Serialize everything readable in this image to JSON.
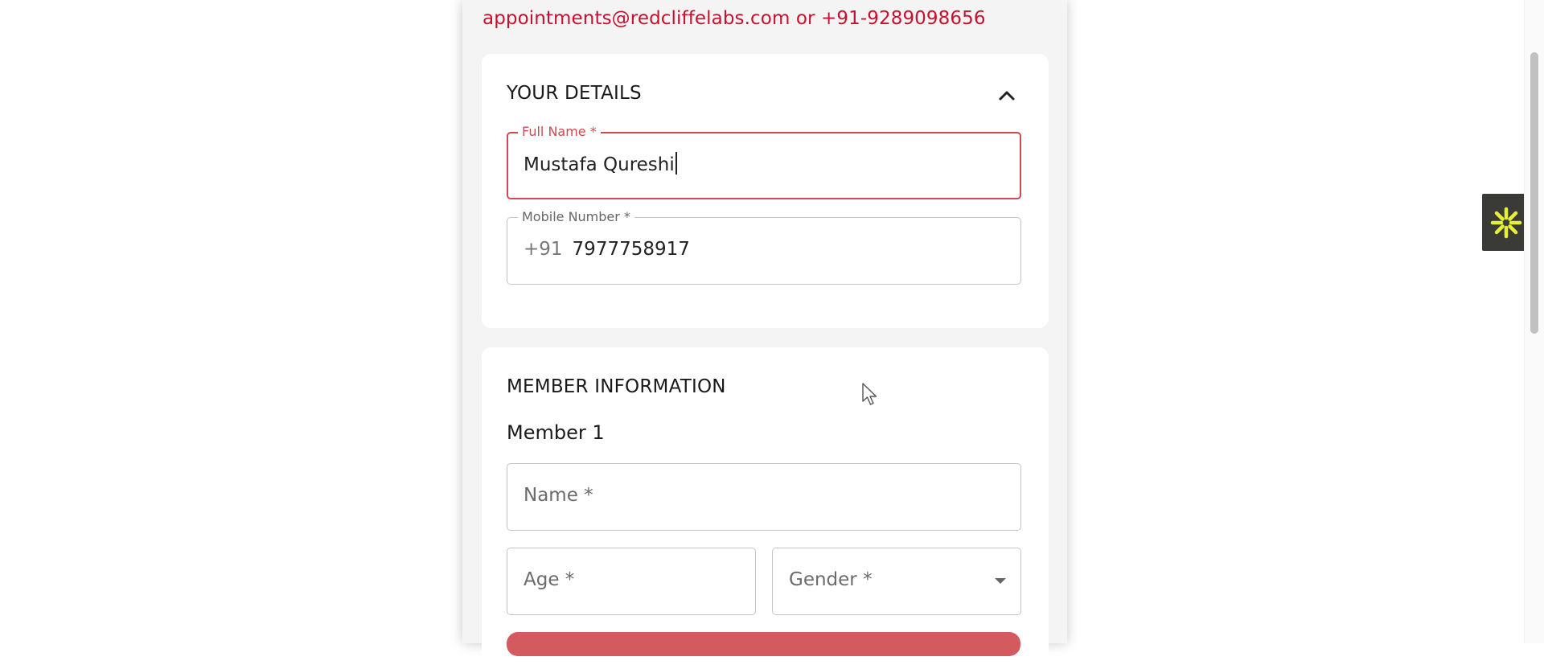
{
  "header": {
    "contact_text": "appointments@redcliffelabs.com or +91-9289098656"
  },
  "details": {
    "title": "YOUR DETAILS",
    "full_name": {
      "label": "Full Name *",
      "value": "Mustafa Qureshi"
    },
    "mobile": {
      "label": "Mobile Number *",
      "prefix": "+91",
      "value": "7977758917"
    }
  },
  "members": {
    "title": "MEMBER INFORMATION",
    "member_label": "Member 1",
    "name_placeholder": "Name *",
    "age_placeholder": "Age *",
    "gender_placeholder": "Gender *"
  },
  "colors": {
    "accent": "#c8102e",
    "focus_border": "#d1484f",
    "button": "#d35a5e",
    "widget_bg": "#3a3a36",
    "widget_icon": "#e6f036"
  },
  "icons": {
    "collapse": "chevron-up-icon",
    "gender_select": "triangle-down-icon",
    "widget": "asterisk-burst-icon"
  }
}
